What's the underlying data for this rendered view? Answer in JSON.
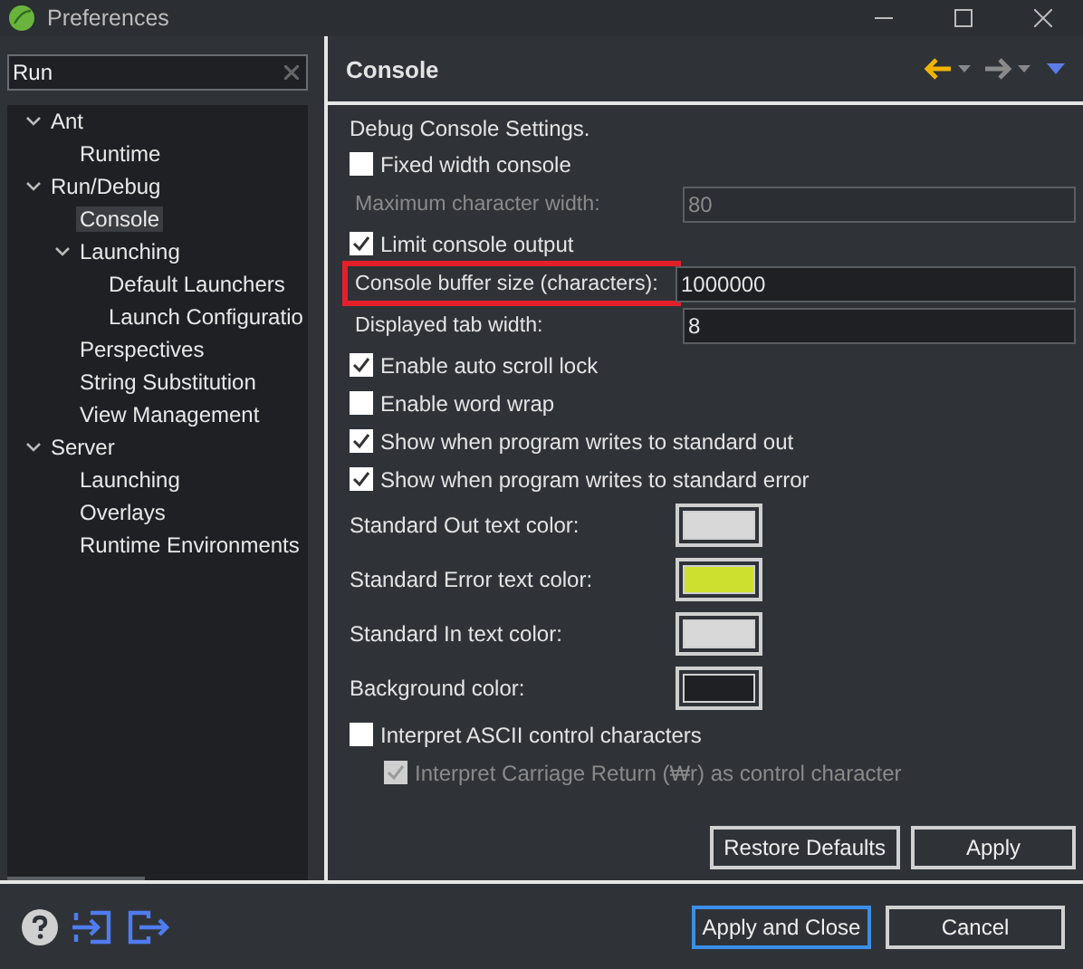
{
  "window": {
    "title": "Preferences"
  },
  "filter": {
    "value": "Run"
  },
  "tree": [
    {
      "label": "Ant",
      "expanded": true,
      "selected": false,
      "children": [
        {
          "label": "Runtime",
          "selected": false
        }
      ]
    },
    {
      "label": "Run/Debug",
      "expanded": true,
      "selected": false,
      "children": [
        {
          "label": "Console",
          "selected": true
        },
        {
          "label": "Launching",
          "expanded": true,
          "selected": false,
          "children": [
            {
              "label": "Default Launchers",
              "selected": false
            },
            {
              "label": "Launch Configuratio",
              "selected": false
            }
          ]
        },
        {
          "label": "Perspectives",
          "selected": false
        },
        {
          "label": "String Substitution",
          "selected": false
        },
        {
          "label": "View Management",
          "selected": false
        }
      ]
    },
    {
      "label": "Server",
      "expanded": true,
      "selected": false,
      "children": [
        {
          "label": "Launching",
          "selected": false
        },
        {
          "label": "Overlays",
          "selected": false
        },
        {
          "label": "Runtime Environments",
          "selected": false
        }
      ]
    }
  ],
  "page": {
    "title": "Console",
    "description": "Debug Console Settings.",
    "settings": [
      {
        "kind": "checkbox",
        "label": "Fixed width console",
        "checked": false,
        "disabled": false
      },
      {
        "kind": "field",
        "label": "Maximum character width:",
        "value": "80",
        "disabled": true,
        "highlighted": false
      },
      {
        "kind": "checkbox",
        "label": "Limit console output",
        "checked": true,
        "disabled": false
      },
      {
        "kind": "field",
        "label": "Console buffer size (characters):",
        "value": "1000000",
        "disabled": false,
        "highlighted": true
      },
      {
        "kind": "field",
        "label": "Displayed tab width:",
        "value": "8",
        "disabled": false,
        "highlighted": false
      },
      {
        "kind": "checkbox",
        "label": "Enable auto scroll lock",
        "checked": true,
        "disabled": false
      },
      {
        "kind": "checkbox",
        "label": "Enable word wrap",
        "checked": false,
        "disabled": false
      },
      {
        "kind": "checkbox",
        "label": "Show when program writes to standard out",
        "checked": true,
        "disabled": false
      },
      {
        "kind": "checkbox",
        "label": "Show when program writes to standard error",
        "checked": true,
        "disabled": false
      },
      {
        "kind": "color",
        "label": "Standard Out text color:",
        "color": "#d8d8d8"
      },
      {
        "kind": "color",
        "label": "Standard Error text color:",
        "color": "#cde030"
      },
      {
        "kind": "color",
        "label": "Standard In text color:",
        "color": "#d8d8d8"
      },
      {
        "kind": "color",
        "label": "Background color:",
        "color": "#1e2023"
      },
      {
        "kind": "checkbox",
        "label": "Interpret ASCII control characters",
        "checked": false,
        "disabled": false,
        "children": [
          {
            "kind": "checkbox",
            "label": "Interpret Carriage Return (₩r) as control character",
            "checked": true,
            "disabled": true
          }
        ]
      }
    ],
    "buttons": [
      "Restore Defaults",
      "Apply"
    ]
  },
  "footer_buttons": [
    {
      "label": "Apply and Close",
      "default": true
    },
    {
      "label": "Cancel",
      "default": false
    }
  ]
}
